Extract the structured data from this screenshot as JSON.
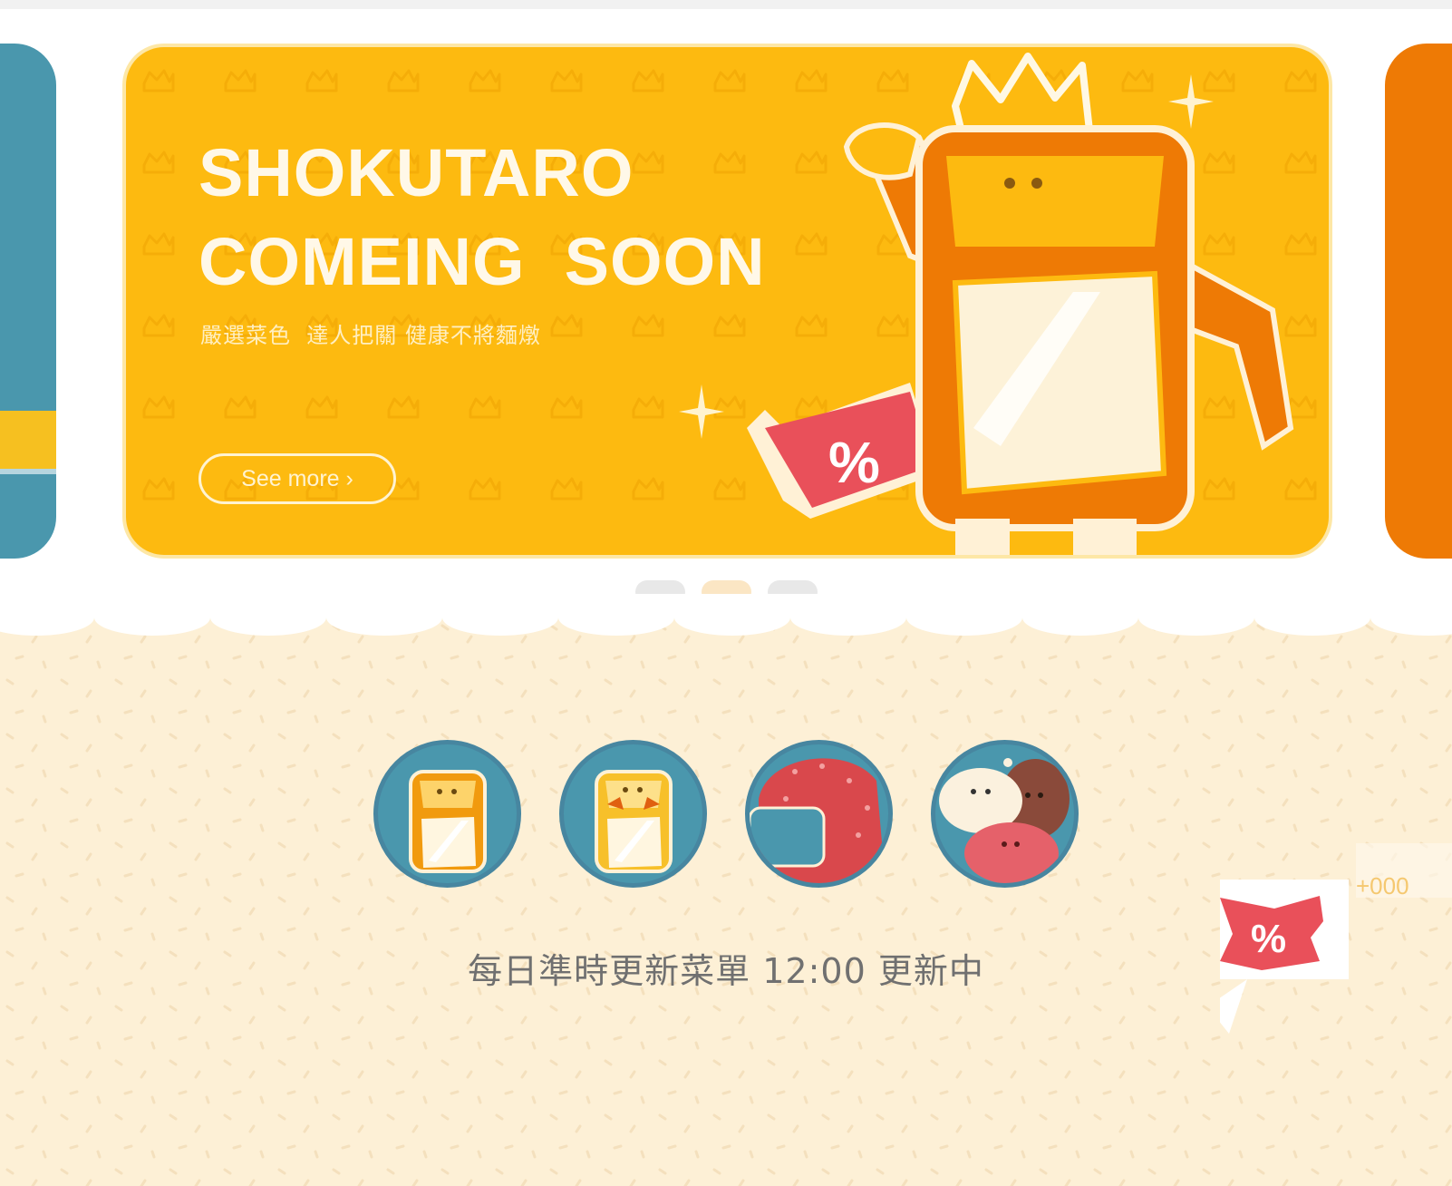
{
  "banner": {
    "title_line1": "SHOKUTARO",
    "title_line2": "COMEING  SOON",
    "subtitle": "嚴選菜色  達人把關 健康不將麵燉",
    "see_more_label": "See more ›",
    "colors": {
      "main": "#fdba10",
      "prev": "#4a97ad",
      "next": "#ee7a05"
    }
  },
  "carousel": {
    "dots": [
      {
        "active": false
      },
      {
        "active": true
      },
      {
        "active": false
      }
    ]
  },
  "categories": [
    {
      "icon": "mascot-blue-icon"
    },
    {
      "icon": "mascot-orange-icon"
    },
    {
      "icon": "mascot-red-icon"
    },
    {
      "icon": "mascot-duo-icon"
    }
  ],
  "update_notice": "每日準時更新菜單 12:00 更新中",
  "coupon_badge": {
    "icon": "coupon-percent-icon",
    "symbol": "%"
  }
}
